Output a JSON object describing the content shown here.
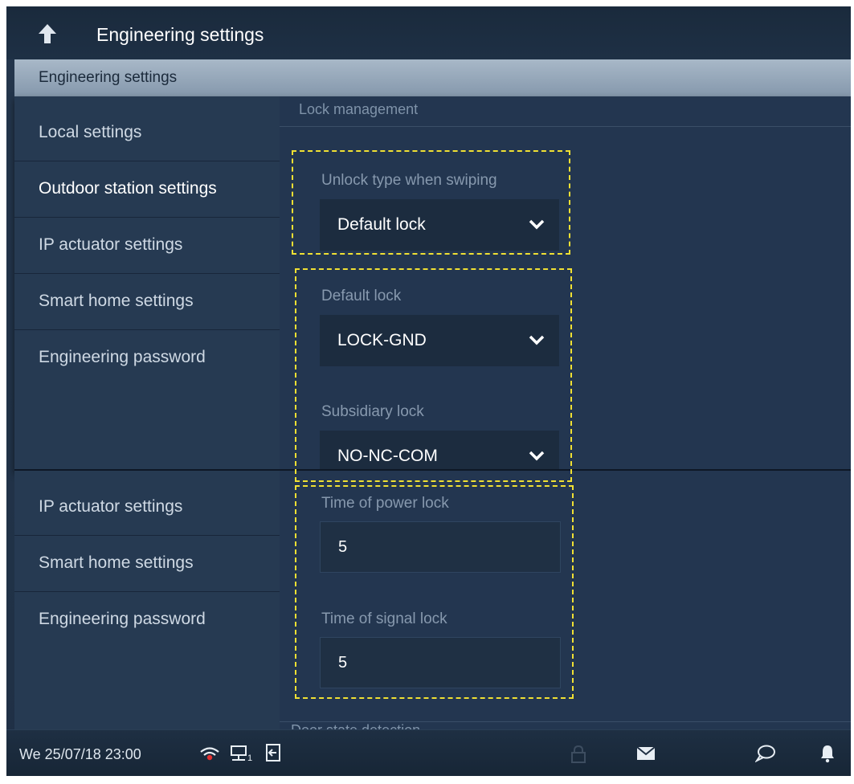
{
  "header": {
    "title": "Engineering settings"
  },
  "engineering_bar": {
    "label": "Engineering settings"
  },
  "nav": {
    "items": [
      {
        "label": "Local settings"
      },
      {
        "label": "Outdoor station settings"
      },
      {
        "label": "IP actuator settings"
      },
      {
        "label": "Smart home settings"
      },
      {
        "label": "Engineering password"
      }
    ]
  },
  "lock_management": {
    "section_title": "Lock management",
    "unlock_type": {
      "label": "Unlock type when swiping",
      "value": "Default lock"
    },
    "default_lock": {
      "label": "Default lock",
      "value": "LOCK-GND"
    },
    "subsidiary_lock": {
      "label": "Subsidiary lock",
      "value": "NO-NC-COM"
    }
  },
  "lower_nav": {
    "items": [
      {
        "label": "IP actuator settings"
      },
      {
        "label": "Smart home settings"
      },
      {
        "label": "Engineering password"
      }
    ]
  },
  "timing": {
    "power_lock": {
      "label": "Time of power lock",
      "value": "5"
    },
    "signal_lock": {
      "label": "Time of signal lock",
      "value": "5"
    }
  },
  "partial_section": {
    "label": "Door state detection"
  },
  "status_bar": {
    "datetime": "We 25/07/18  23:00",
    "network_index": "1",
    "icons": [
      "wifi-off-icon",
      "network-icon",
      "exit-icon",
      "lock-icon",
      "mail-icon",
      "chat-icon",
      "bell-icon"
    ]
  },
  "colors": {
    "background": "#24364c",
    "highlight_border": "#f0e033",
    "status_alert": "#e03030"
  }
}
